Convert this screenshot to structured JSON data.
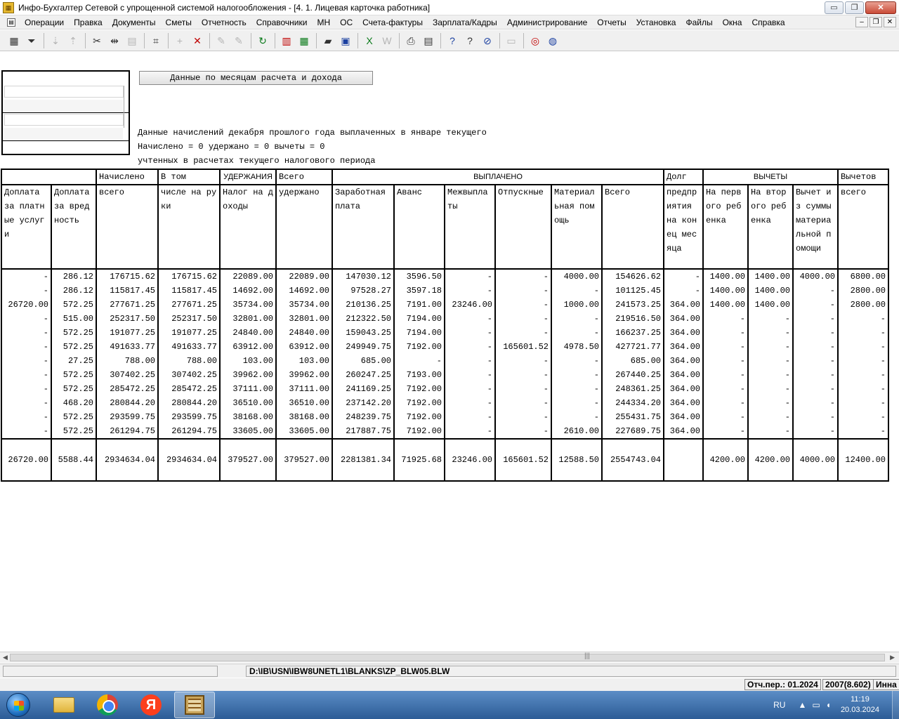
{
  "window": {
    "title": "Инфо-Бухгалтер Сетевой с упрощенной системой налогообложения - [4. 1. Лицевая карточка работника]",
    "buttons": {
      "minimize": "▭",
      "restore": "❐",
      "close": "✕"
    }
  },
  "menu": {
    "items": [
      "Операции",
      "Правка",
      "Документы",
      "Сметы",
      "Отчетность",
      "Справочники",
      "МН",
      "ОС",
      "Счета-фактуры",
      "Зарплата/Кадры",
      "Администрирование",
      "Отчеты",
      "Установка",
      "Файлы",
      "Окна",
      "Справка"
    ],
    "mdi": {
      "minimize": "–",
      "restore": "❐",
      "close": "✕"
    }
  },
  "toolbar": {
    "icons": [
      {
        "name": "table-icon",
        "glyph": "▦",
        "state": "on"
      },
      {
        "name": "filter-icon",
        "glyph": "⏷",
        "state": "on"
      },
      {
        "name": "sort-asc-icon",
        "glyph": "⇣",
        "state": "off"
      },
      {
        "name": "sort-desc-icon",
        "glyph": "⇡",
        "state": "off"
      },
      {
        "name": "cut-icon",
        "glyph": "✂",
        "state": "on"
      },
      {
        "name": "merge-icon",
        "glyph": "⇹",
        "state": "on"
      },
      {
        "name": "paste-icon",
        "glyph": "▤",
        "state": "off"
      },
      {
        "name": "counter-icon",
        "glyph": "⌗",
        "state": "on"
      },
      {
        "name": "add-icon",
        "glyph": "+",
        "state": "off"
      },
      {
        "name": "delete-icon",
        "glyph": "✕",
        "state": "red"
      },
      {
        "name": "pen-icon",
        "glyph": "✎",
        "state": "off"
      },
      {
        "name": "pen-select-icon",
        "glyph": "✎",
        "state": "off"
      },
      {
        "name": "refresh-icon",
        "glyph": "↻",
        "state": "green"
      },
      {
        "name": "pdf-icon",
        "glyph": "▥",
        "state": "red"
      },
      {
        "name": "calculator-icon",
        "glyph": "▦",
        "state": "green"
      },
      {
        "name": "open-folder-icon",
        "glyph": "▰",
        "state": "on"
      },
      {
        "name": "save-icon",
        "glyph": "▣",
        "state": "blue"
      },
      {
        "name": "excel-icon",
        "glyph": "X",
        "state": "green"
      },
      {
        "name": "word-icon",
        "glyph": "W",
        "state": "off"
      },
      {
        "name": "print-icon",
        "glyph": "⎙",
        "state": "on"
      },
      {
        "name": "preview-icon",
        "glyph": "▤",
        "state": "on"
      },
      {
        "name": "help-icon",
        "glyph": "?",
        "state": "blue"
      },
      {
        "name": "context-help-icon",
        "glyph": "?",
        "state": "on"
      },
      {
        "name": "compass-icon",
        "glyph": "⊘",
        "state": "blue"
      },
      {
        "name": "report-icon",
        "glyph": "▭",
        "state": "off"
      },
      {
        "name": "lifebuoy-icon",
        "glyph": "◎",
        "state": "red"
      },
      {
        "name": "globe-icon",
        "glyph": "◍",
        "state": "blue"
      }
    ]
  },
  "content": {
    "month_button": "Данные по месяцам расчета и дохода",
    "info_line1": "Данные начислений декабря прошлого года выплаченных в январе текущего",
    "info_line2": "Начислено = 0 удержано = 0 вычеты = 0",
    "info_line3": "учтенных в расчетах текущего налогового периода"
  },
  "table": {
    "group_headers": {
      "accrued": "Начислено",
      "including": "В том",
      "deductions": "УДЕРЖАНИЯ",
      "total_withheld": "Всего",
      "paid": "ВЫПЛАЧЕНО",
      "debt": "Долг",
      "tax_deductions": "ВЫЧЕТЫ",
      "deductions_total": "Вычетов"
    },
    "columns": [
      "Доплата за платные услуги",
      "Доплата за вред ность",
      "всего",
      "числе на руки",
      "Налог на доходы",
      "удержано",
      "Заработная плата",
      "Аванс",
      "Межвыпла ты",
      "Отпускные",
      "Материал ьная помощь",
      "Всего",
      "предпр иятия на конец месяца",
      "На первого ребенка",
      "На второго ребенка",
      "Вычет из суммы материа льной помощи",
      "всего"
    ],
    "rows": [
      [
        "-",
        "286.12",
        "176715.62",
        "176715.62",
        "22089.00",
        "22089.00",
        "147030.12",
        "3596.50",
        "-",
        "-",
        "4000.00",
        "154626.62",
        "-",
        "1400.00",
        "1400.00",
        "4000.00",
        "6800.00"
      ],
      [
        "-",
        "286.12",
        "115817.45",
        "115817.45",
        "14692.00",
        "14692.00",
        "97528.27",
        "3597.18",
        "-",
        "-",
        "-",
        "101125.45",
        "-",
        "1400.00",
        "1400.00",
        "-",
        "2800.00"
      ],
      [
        "26720.00",
        "572.25",
        "277671.25",
        "277671.25",
        "35734.00",
        "35734.00",
        "210136.25",
        "7191.00",
        "23246.00",
        "-",
        "1000.00",
        "241573.25",
        "364.00",
        "1400.00",
        "1400.00",
        "-",
        "2800.00"
      ],
      [
        "-",
        "515.00",
        "252317.50",
        "252317.50",
        "32801.00",
        "32801.00",
        "212322.50",
        "7194.00",
        "-",
        "-",
        "-",
        "219516.50",
        "364.00",
        "-",
        "-",
        "-",
        "-"
      ],
      [
        "-",
        "572.25",
        "191077.25",
        "191077.25",
        "24840.00",
        "24840.00",
        "159043.25",
        "7194.00",
        "-",
        "-",
        "-",
        "166237.25",
        "364.00",
        "-",
        "-",
        "-",
        "-"
      ],
      [
        "-",
        "572.25",
        "491633.77",
        "491633.77",
        "63912.00",
        "63912.00",
        "249949.75",
        "7192.00",
        "-",
        "165601.52",
        "4978.50",
        "427721.77",
        "364.00",
        "-",
        "-",
        "-",
        "-"
      ],
      [
        "-",
        "27.25",
        "788.00",
        "788.00",
        "103.00",
        "103.00",
        "685.00",
        "-",
        "-",
        "-",
        "-",
        "685.00",
        "364.00",
        "-",
        "-",
        "-",
        "-"
      ],
      [
        "-",
        "572.25",
        "307402.25",
        "307402.25",
        "39962.00",
        "39962.00",
        "260247.25",
        "7193.00",
        "-",
        "-",
        "-",
        "267440.25",
        "364.00",
        "-",
        "-",
        "-",
        "-"
      ],
      [
        "-",
        "572.25",
        "285472.25",
        "285472.25",
        "37111.00",
        "37111.00",
        "241169.25",
        "7192.00",
        "-",
        "-",
        "-",
        "248361.25",
        "364.00",
        "-",
        "-",
        "-",
        "-"
      ],
      [
        "-",
        "468.20",
        "280844.20",
        "280844.20",
        "36510.00",
        "36510.00",
        "237142.20",
        "7192.00",
        "-",
        "-",
        "-",
        "244334.20",
        "364.00",
        "-",
        "-",
        "-",
        "-"
      ],
      [
        "-",
        "572.25",
        "293599.75",
        "293599.75",
        "38168.00",
        "38168.00",
        "248239.75",
        "7192.00",
        "-",
        "-",
        "-",
        "255431.75",
        "364.00",
        "-",
        "-",
        "-",
        "-"
      ],
      [
        "-",
        "572.25",
        "261294.75",
        "261294.75",
        "33605.00",
        "33605.00",
        "217887.75",
        "7192.00",
        "-",
        "-",
        "2610.00",
        "227689.75",
        "364.00",
        "-",
        "-",
        "-",
        "-"
      ]
    ],
    "totals": [
      "26720.00",
      "5588.44",
      "2934634.04",
      "2934634.04",
      "379527.00",
      "379527.00",
      "2281381.34",
      "71925.68",
      "23246.00",
      "165601.52",
      "12588.50",
      "2554743.04",
      "",
      "4200.00",
      "4200.00",
      "4000.00",
      "12400.00"
    ]
  },
  "statusbar": {
    "file_path": "D:\\IB\\USN\\IBW8UNETL1\\BLANKS\\ZP_BLW05.BLW",
    "period": "Отч.пер.: 01.2024",
    "version": "2007(8.602)",
    "user": "Инна"
  },
  "taskbar": {
    "language": "RU",
    "time": "11:19",
    "date": "20.03.2024"
  }
}
